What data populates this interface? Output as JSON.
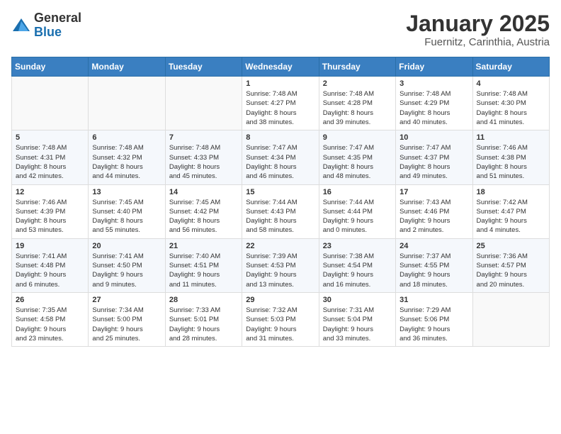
{
  "header": {
    "logo_general": "General",
    "logo_blue": "Blue",
    "title": "January 2025",
    "subtitle": "Fuernitz, Carinthia, Austria"
  },
  "calendar": {
    "days_of_week": [
      "Sunday",
      "Monday",
      "Tuesday",
      "Wednesday",
      "Thursday",
      "Friday",
      "Saturday"
    ],
    "weeks": [
      [
        {
          "day": "",
          "info": ""
        },
        {
          "day": "",
          "info": ""
        },
        {
          "day": "",
          "info": ""
        },
        {
          "day": "1",
          "info": "Sunrise: 7:48 AM\nSunset: 4:27 PM\nDaylight: 8 hours\nand 38 minutes."
        },
        {
          "day": "2",
          "info": "Sunrise: 7:48 AM\nSunset: 4:28 PM\nDaylight: 8 hours\nand 39 minutes."
        },
        {
          "day": "3",
          "info": "Sunrise: 7:48 AM\nSunset: 4:29 PM\nDaylight: 8 hours\nand 40 minutes."
        },
        {
          "day": "4",
          "info": "Sunrise: 7:48 AM\nSunset: 4:30 PM\nDaylight: 8 hours\nand 41 minutes."
        }
      ],
      [
        {
          "day": "5",
          "info": "Sunrise: 7:48 AM\nSunset: 4:31 PM\nDaylight: 8 hours\nand 42 minutes."
        },
        {
          "day": "6",
          "info": "Sunrise: 7:48 AM\nSunset: 4:32 PM\nDaylight: 8 hours\nand 44 minutes."
        },
        {
          "day": "7",
          "info": "Sunrise: 7:48 AM\nSunset: 4:33 PM\nDaylight: 8 hours\nand 45 minutes."
        },
        {
          "day": "8",
          "info": "Sunrise: 7:47 AM\nSunset: 4:34 PM\nDaylight: 8 hours\nand 46 minutes."
        },
        {
          "day": "9",
          "info": "Sunrise: 7:47 AM\nSunset: 4:35 PM\nDaylight: 8 hours\nand 48 minutes."
        },
        {
          "day": "10",
          "info": "Sunrise: 7:47 AM\nSunset: 4:37 PM\nDaylight: 8 hours\nand 49 minutes."
        },
        {
          "day": "11",
          "info": "Sunrise: 7:46 AM\nSunset: 4:38 PM\nDaylight: 8 hours\nand 51 minutes."
        }
      ],
      [
        {
          "day": "12",
          "info": "Sunrise: 7:46 AM\nSunset: 4:39 PM\nDaylight: 8 hours\nand 53 minutes."
        },
        {
          "day": "13",
          "info": "Sunrise: 7:45 AM\nSunset: 4:40 PM\nDaylight: 8 hours\nand 55 minutes."
        },
        {
          "day": "14",
          "info": "Sunrise: 7:45 AM\nSunset: 4:42 PM\nDaylight: 8 hours\nand 56 minutes."
        },
        {
          "day": "15",
          "info": "Sunrise: 7:44 AM\nSunset: 4:43 PM\nDaylight: 8 hours\nand 58 minutes."
        },
        {
          "day": "16",
          "info": "Sunrise: 7:44 AM\nSunset: 4:44 PM\nDaylight: 9 hours\nand 0 minutes."
        },
        {
          "day": "17",
          "info": "Sunrise: 7:43 AM\nSunset: 4:46 PM\nDaylight: 9 hours\nand 2 minutes."
        },
        {
          "day": "18",
          "info": "Sunrise: 7:42 AM\nSunset: 4:47 PM\nDaylight: 9 hours\nand 4 minutes."
        }
      ],
      [
        {
          "day": "19",
          "info": "Sunrise: 7:41 AM\nSunset: 4:48 PM\nDaylight: 9 hours\nand 6 minutes."
        },
        {
          "day": "20",
          "info": "Sunrise: 7:41 AM\nSunset: 4:50 PM\nDaylight: 9 hours\nand 9 minutes."
        },
        {
          "day": "21",
          "info": "Sunrise: 7:40 AM\nSunset: 4:51 PM\nDaylight: 9 hours\nand 11 minutes."
        },
        {
          "day": "22",
          "info": "Sunrise: 7:39 AM\nSunset: 4:53 PM\nDaylight: 9 hours\nand 13 minutes."
        },
        {
          "day": "23",
          "info": "Sunrise: 7:38 AM\nSunset: 4:54 PM\nDaylight: 9 hours\nand 16 minutes."
        },
        {
          "day": "24",
          "info": "Sunrise: 7:37 AM\nSunset: 4:55 PM\nDaylight: 9 hours\nand 18 minutes."
        },
        {
          "day": "25",
          "info": "Sunrise: 7:36 AM\nSunset: 4:57 PM\nDaylight: 9 hours\nand 20 minutes."
        }
      ],
      [
        {
          "day": "26",
          "info": "Sunrise: 7:35 AM\nSunset: 4:58 PM\nDaylight: 9 hours\nand 23 minutes."
        },
        {
          "day": "27",
          "info": "Sunrise: 7:34 AM\nSunset: 5:00 PM\nDaylight: 9 hours\nand 25 minutes."
        },
        {
          "day": "28",
          "info": "Sunrise: 7:33 AM\nSunset: 5:01 PM\nDaylight: 9 hours\nand 28 minutes."
        },
        {
          "day": "29",
          "info": "Sunrise: 7:32 AM\nSunset: 5:03 PM\nDaylight: 9 hours\nand 31 minutes."
        },
        {
          "day": "30",
          "info": "Sunrise: 7:31 AM\nSunset: 5:04 PM\nDaylight: 9 hours\nand 33 minutes."
        },
        {
          "day": "31",
          "info": "Sunrise: 7:29 AM\nSunset: 5:06 PM\nDaylight: 9 hours\nand 36 minutes."
        },
        {
          "day": "",
          "info": ""
        }
      ]
    ]
  }
}
